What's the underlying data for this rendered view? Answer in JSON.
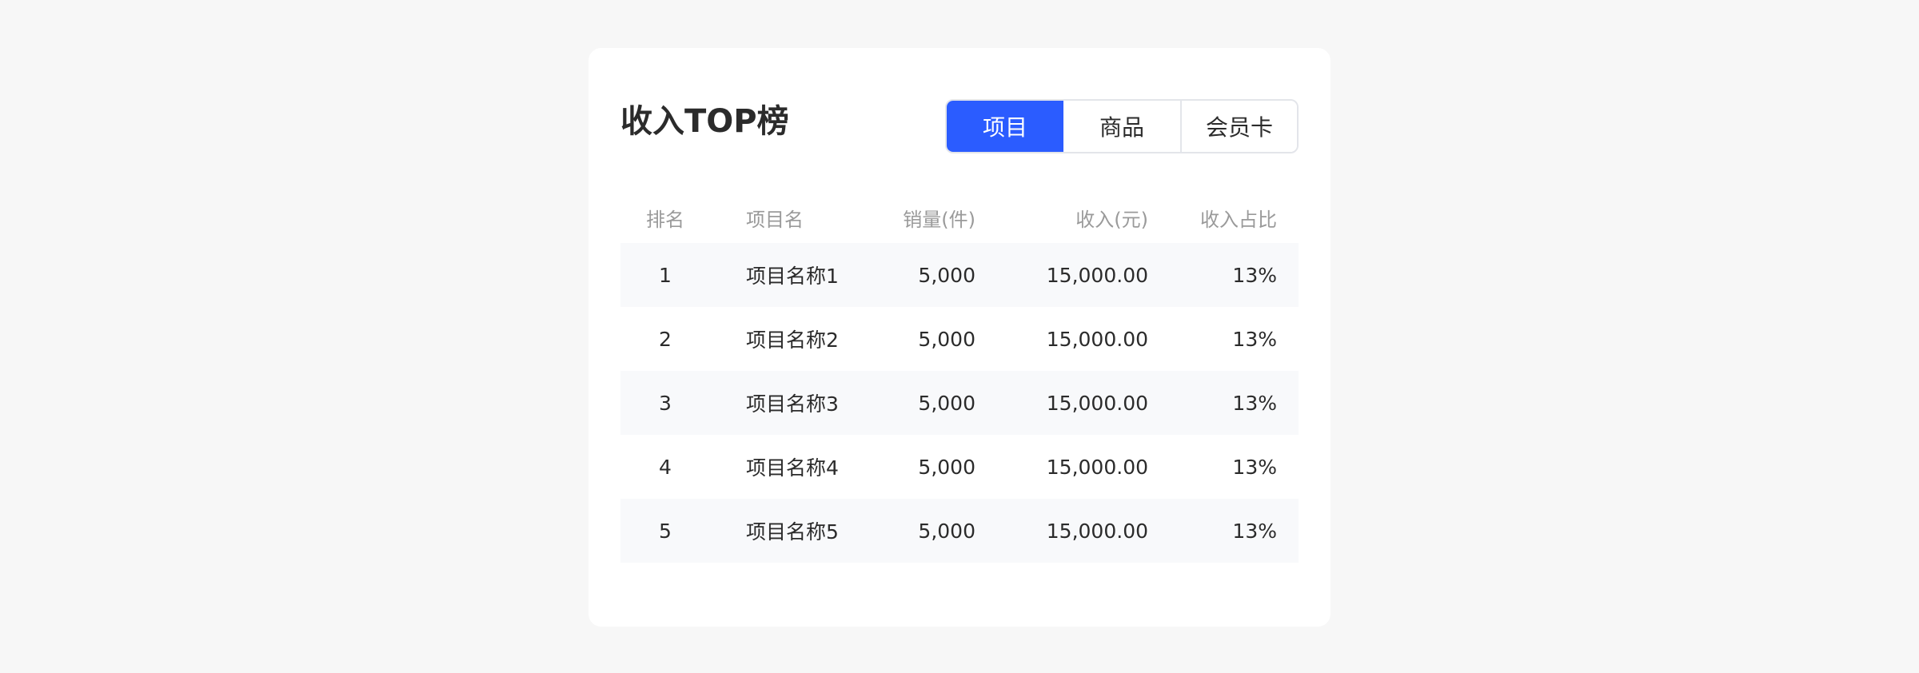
{
  "card": {
    "title": "收入TOP榜",
    "tabs": [
      {
        "label": "项目",
        "active": true
      },
      {
        "label": "商品",
        "active": false
      },
      {
        "label": "会员卡",
        "active": false
      }
    ]
  },
  "table": {
    "headers": {
      "rank": "排名",
      "name": "项目名",
      "qty": "销量(件)",
      "revenue": "收入(元)",
      "share": "收入占比"
    },
    "rows": [
      {
        "rank": "1",
        "name": "项目名称1",
        "qty": "5,000",
        "revenue": "15,000.00",
        "share": "13%"
      },
      {
        "rank": "2",
        "name": "项目名称2",
        "qty": "5,000",
        "revenue": "15,000.00",
        "share": "13%"
      },
      {
        "rank": "3",
        "name": "项目名称3",
        "qty": "5,000",
        "revenue": "15,000.00",
        "share": "13%"
      },
      {
        "rank": "4",
        "name": "项目名称4",
        "qty": "5,000",
        "revenue": "15,000.00",
        "share": "13%"
      },
      {
        "rank": "5",
        "name": "项目名称5",
        "qty": "5,000",
        "revenue": "15,000.00",
        "share": "13%"
      }
    ]
  },
  "colors": {
    "accent": "#2b5cff",
    "page_background": "#f7f7f7",
    "row_stripe": "#f8f9fb",
    "header_text": "#9a9a9a"
  }
}
